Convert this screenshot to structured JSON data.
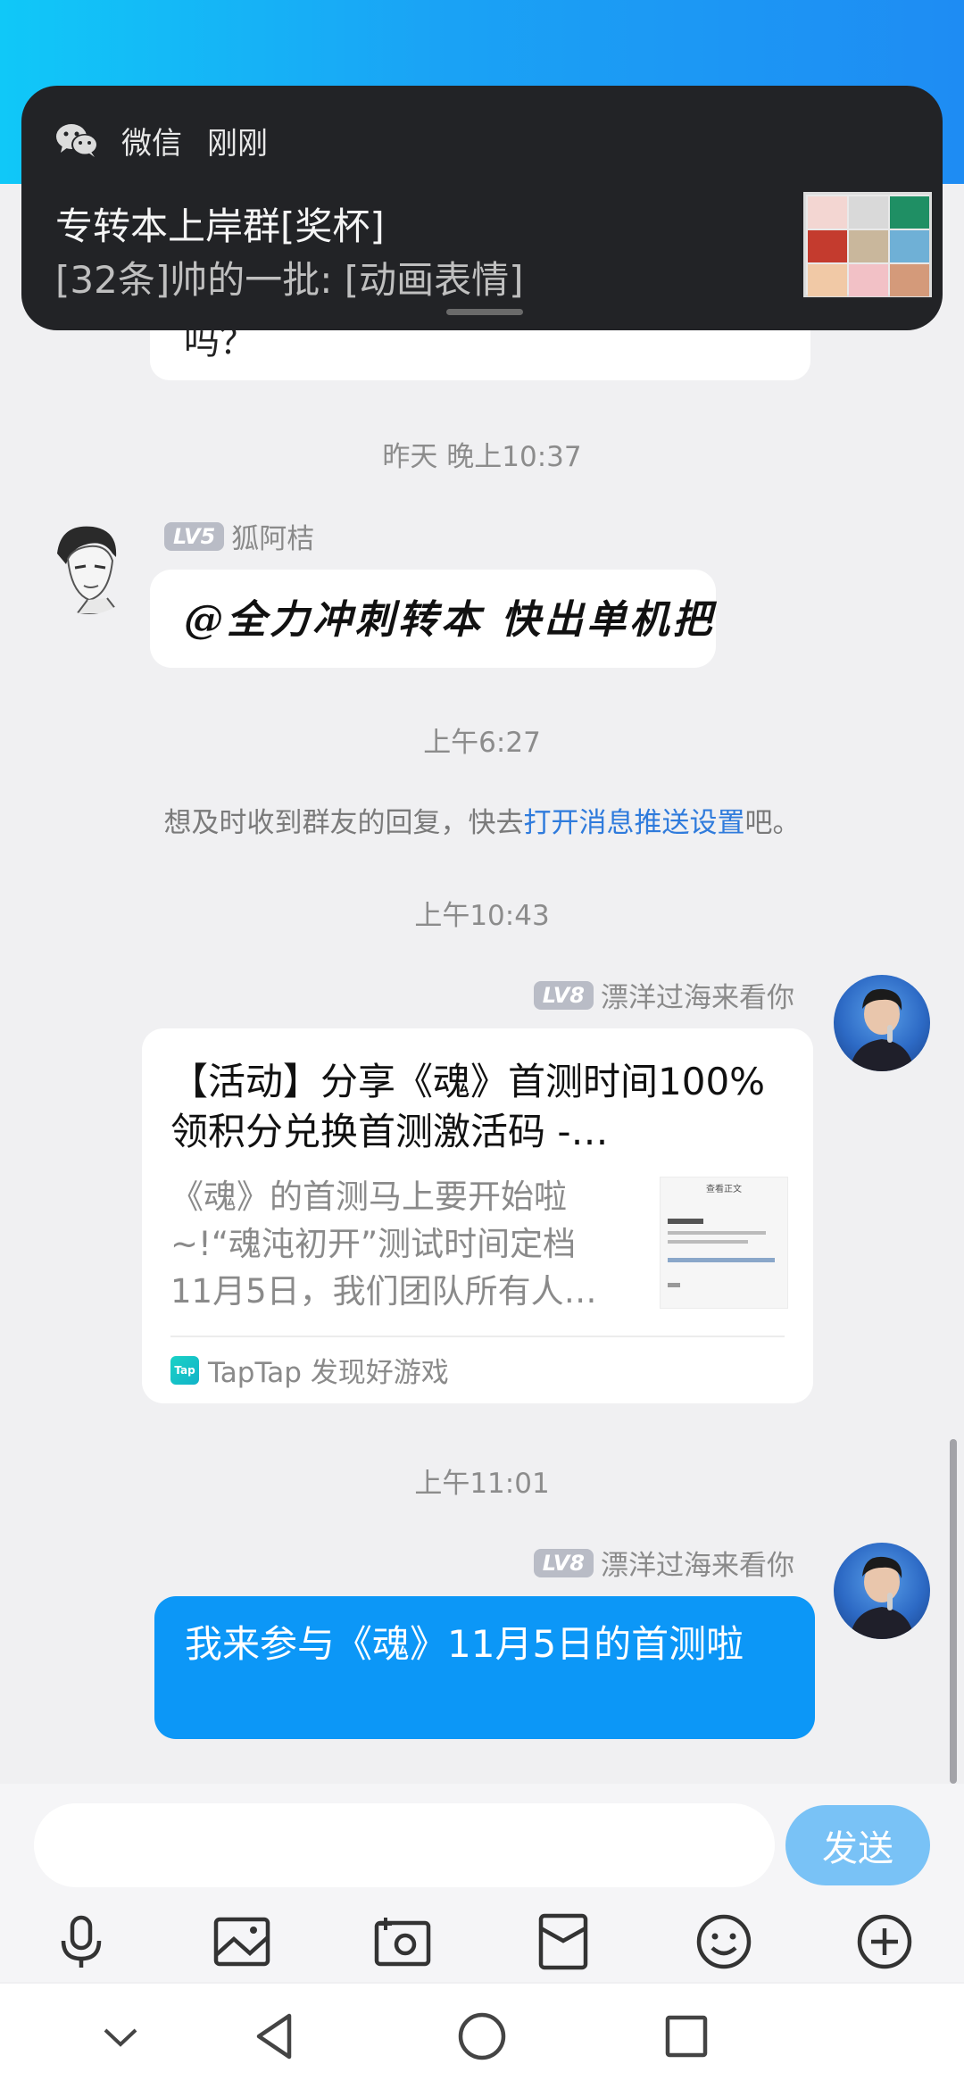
{
  "notification": {
    "app": "微信",
    "time": "刚刚",
    "title": "专转本上岸群[奖杯]",
    "body": "[32条]帅的一批: [动画表情]",
    "thumb_colors": [
      "#f3d6d2",
      "#d9d9d9",
      "#1f8f64",
      "#c43b2e",
      "#c9b79c",
      "#6fb0d6",
      "#f1c9a6",
      "#f2c1c6",
      "#d49a7a"
    ]
  },
  "chat": {
    "partial_text": "吗？",
    "messages": [
      {
        "time": "昨天 晚上10:37",
        "sender_level": "LV5",
        "sender_name": "狐阿桔",
        "text": "@全力冲刺转本 快出单机把"
      },
      {
        "time": "上午6:27"
      }
    ],
    "system_tip": {
      "prefix": "想及时收到群友的回复，快去",
      "link": "打开消息推送设置",
      "suffix": "吧。"
    },
    "card_time": "上午10:43",
    "card_sender": {
      "level": "LV8",
      "name": "漂洋过海来看你"
    },
    "card": {
      "title": "【活动】分享《魂》首测时间100%领积分兑换首测激活码 -…",
      "desc": "《魂》的首测马上要开始啦~!“魂沌初开”测试时间定档11月5日，我们团队所有人…",
      "thumb_heading": "查看正文",
      "source": "TapTap 发现好游戏"
    },
    "last_time": "上午11:01",
    "last_sender": {
      "level": "LV8",
      "name": "漂洋过海来看你"
    },
    "last_text": "我来参与《魂》11月5日的首测啦"
  },
  "input": {
    "value": "",
    "placeholder": "",
    "send_label": "发送"
  },
  "toolbar": [
    "mic-icon",
    "image-icon",
    "camera-icon",
    "red-packet-icon",
    "emoji-icon",
    "plus-icon"
  ],
  "navbar": [
    "collapse-icon",
    "back-icon",
    "home-icon",
    "recents-icon"
  ],
  "colors": {
    "accent": "#0c97f7",
    "send_disabled": "#79c2f6",
    "link": "#2f7bdc"
  }
}
